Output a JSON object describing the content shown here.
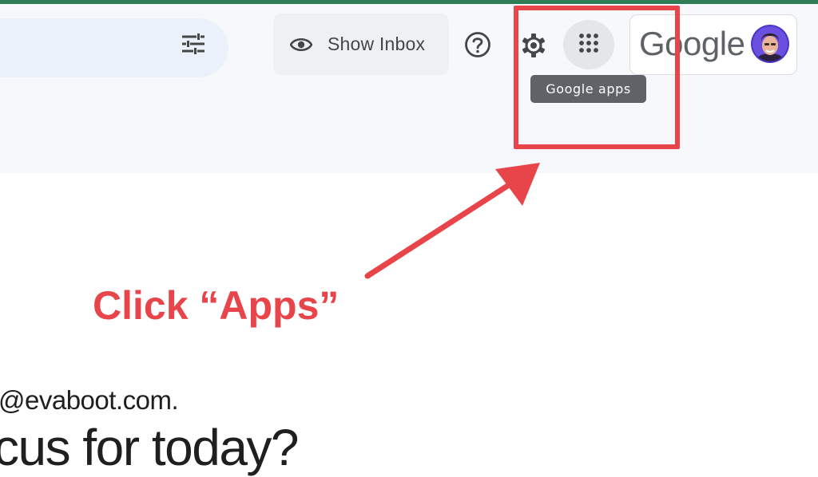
{
  "header": {
    "show_inbox_label": "Show Inbox",
    "tooltip": "Google apps",
    "brand": "Google"
  },
  "icons": {
    "filter": "tune-icon",
    "eye": "eye-icon",
    "help": "help-icon",
    "settings": "gear-icon",
    "apps": "apps-grid-icon"
  },
  "annotation": {
    "callout": "Click “Apps”",
    "color": "#e8454a"
  },
  "content": {
    "email_fragment": "@evaboot.com.",
    "heading_fragment": "cus for today?"
  },
  "colors": {
    "top_strip": "#2e7d57",
    "header_bg": "#f6f8fc",
    "search_bg": "#eaf1fb",
    "tooltip_bg": "#5f6368"
  }
}
